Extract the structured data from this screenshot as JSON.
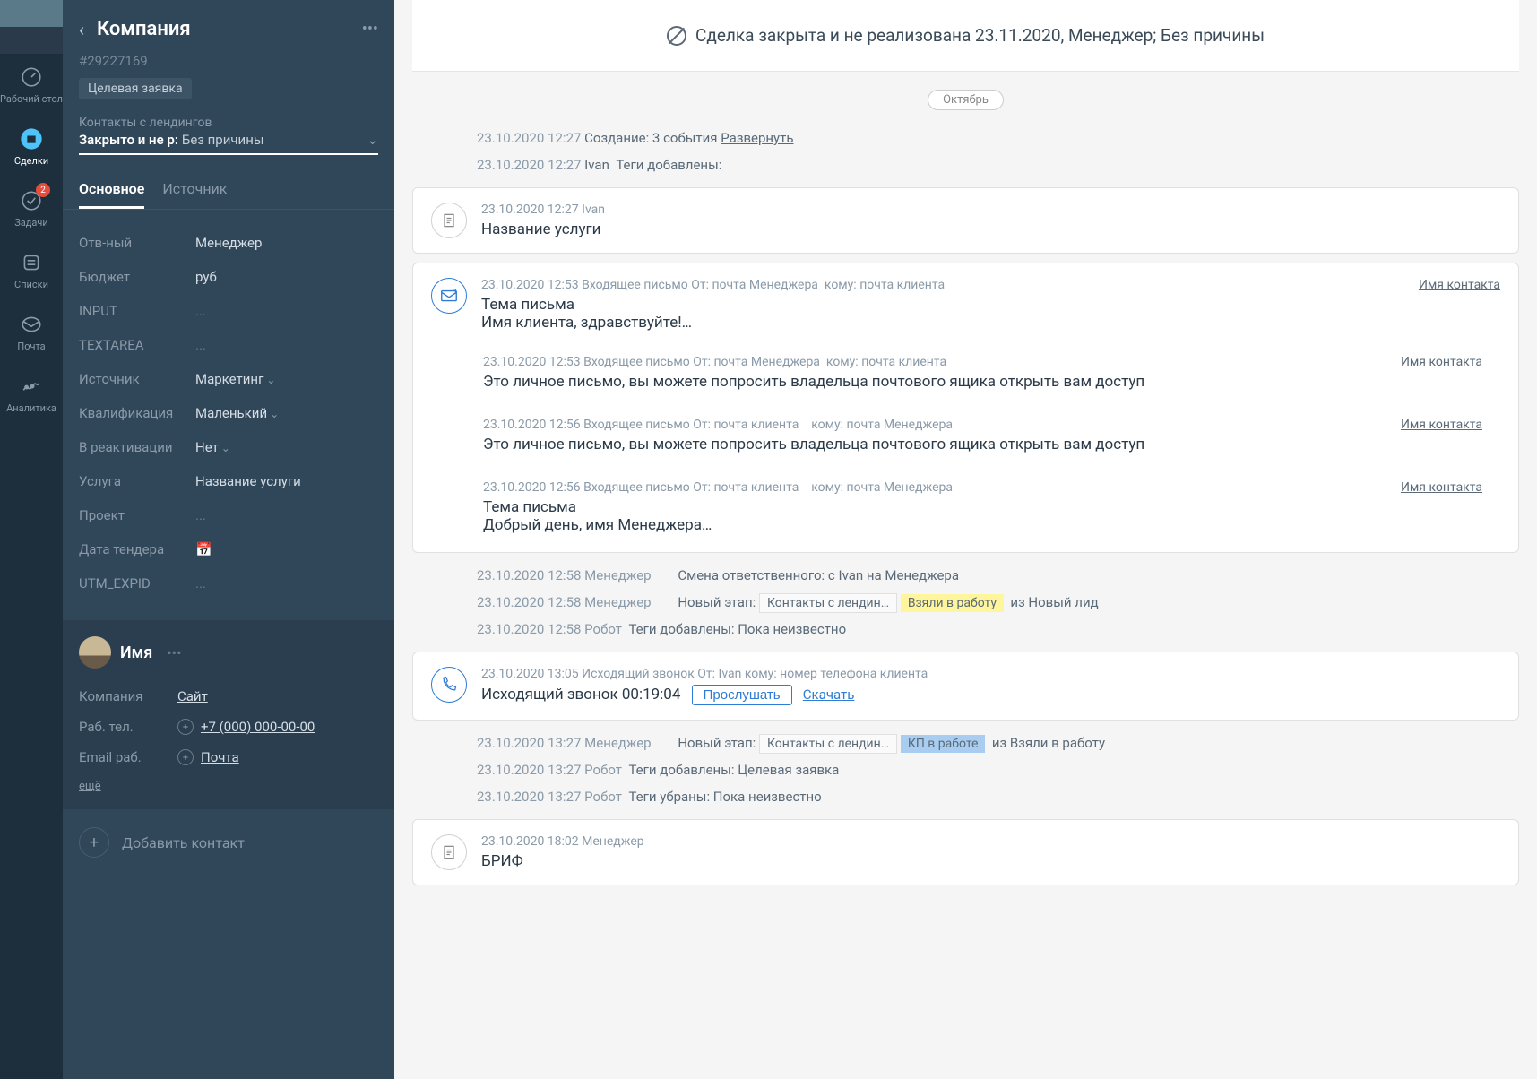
{
  "nav": {
    "items": [
      {
        "label": "Рабочий стол"
      },
      {
        "label": "Сделки"
      },
      {
        "label": "Задачи",
        "badge": "2"
      },
      {
        "label": "Списки"
      },
      {
        "label": "Почта"
      },
      {
        "label": "Аналитика"
      }
    ]
  },
  "deal": {
    "title": "Компания",
    "id": "#29227169",
    "tag": "Целевая заявка",
    "pipeline_label": "Контакты с лендингов",
    "status": "Закрыто и не р:",
    "reason": "Без причины",
    "tabs": [
      {
        "label": "Основное"
      },
      {
        "label": "Источник"
      }
    ],
    "fields": [
      {
        "label": "Отв-ный",
        "value": "Менеджер"
      },
      {
        "label": "Бюджет",
        "value": "руб"
      },
      {
        "label": "INPUT",
        "value": "...",
        "empty": true
      },
      {
        "label": "TEXTAREA",
        "value": "...",
        "empty": true
      },
      {
        "label": "Источник",
        "value": "Маркетинг",
        "dropdown": true
      },
      {
        "label": "Квалификация",
        "value": "Маленький",
        "dropdown": true
      },
      {
        "label": "В реактивации",
        "value": "Нет",
        "dropdown": true
      },
      {
        "label": "Услуга",
        "value": "Название услуги"
      },
      {
        "label": "Проект",
        "value": "...",
        "empty": true
      },
      {
        "label": "Дата тендера",
        "value": "📅",
        "empty": true
      },
      {
        "label": "UTM_EXPID",
        "value": "...",
        "empty": true
      }
    ]
  },
  "contact": {
    "name": "Имя",
    "fields": {
      "company_label": "Компания",
      "company_value": "Сайт",
      "phone_label": "Раб. тел.",
      "phone_value": "+7 (000) 000-00-00",
      "email_label": "Email раб.",
      "email_value": "Почта"
    },
    "more": "ещё",
    "add": "Добавить контакт"
  },
  "banner": "Сделка закрыта и не реализована 23.11.2020, Менеджер; Без причины",
  "month": "Октябрь",
  "timeline": {
    "line1_time": "23.10.2020 12:27",
    "line1_text": "Создание: 3 события",
    "line1_link": "Развернуть",
    "line2_time": "23.10.2020 12:27",
    "line2_user": "Ivan",
    "line2_text": "Теги добавлены:",
    "note1_time": "23.10.2020 12:27 Ivan",
    "note1_title": "Название услуги",
    "email1_meta": "23.10.2020 12:53 Входящее письмо От:",
    "email1_from": "почта Менеджера",
    "email1_to_label": "кому:",
    "email1_to": "почта клиента",
    "email1_subject": "Тема письма",
    "email1_body": "Имя клиента, здравствуйте!…",
    "email_contact": "Имя контакта",
    "email2_meta": "23.10.2020 12:53 Входящее письмо От:",
    "email2_from": "почта Менеджера",
    "email2_to": "почта клиента",
    "email2_body": "Это личное письмо, вы можете попросить владельца почтового ящика открыть вам доступ",
    "email3_meta": "23.10.2020 12:56 Входящее письмо От:",
    "email3_from": "почта клиента",
    "email3_to": "почта Менеджера",
    "email3_body": "Это личное письмо, вы можете попросить владельца почтового ящика открыть вам доступ",
    "email4_meta": "23.10.2020 12:56 Входящее письмо От:",
    "email4_from": "почта клиента",
    "email4_to": "почта Менеджера",
    "email4_subject": "Тема письма",
    "email4_body": "Добрый день, имя Менеджера…",
    "line3_time": "23.10.2020 12:58 Менеджер",
    "line3_text": "Смена ответственного: с Ivan на Менеджера",
    "line4_time": "23.10.2020 12:58 Менеджер",
    "line4_label": "Новый этап:",
    "line4_from_stage": "Контакты с лендин…",
    "line4_to_stage": "Взяли в работу",
    "line4_suffix": "из Новый лид",
    "line5_time": "23.10.2020 12:58 Робот",
    "line5_text": "Теги добавлены: Пока неизвестно",
    "call_meta": "23.10.2020 13:05 Исходящий звонок От:",
    "call_from": "Ivan",
    "call_to_label": "кому:",
    "call_to": "номер телефона клиента",
    "call_title": "Исходящий звонок 00:19:04",
    "call_listen": "Прослушать",
    "call_download": "Скачать",
    "line6_time": "23.10.2020 13:27 Менеджер",
    "line6_label": "Новый этап:",
    "line6_from_stage": "Контакты с лендин…",
    "line6_to_stage": "КП в работе",
    "line6_suffix": "из Взяли в работу",
    "line7_time": "23.10.2020 13:27 Робот",
    "line7_text": "Теги добавлены: Целевая заявка",
    "line8_time": "23.10.2020 13:27 Робот",
    "line8_text": "Теги убраны: Пока неизвестно",
    "note2_time": "23.10.2020 18:02 Менеджер",
    "note2_title": "БРИФ"
  }
}
